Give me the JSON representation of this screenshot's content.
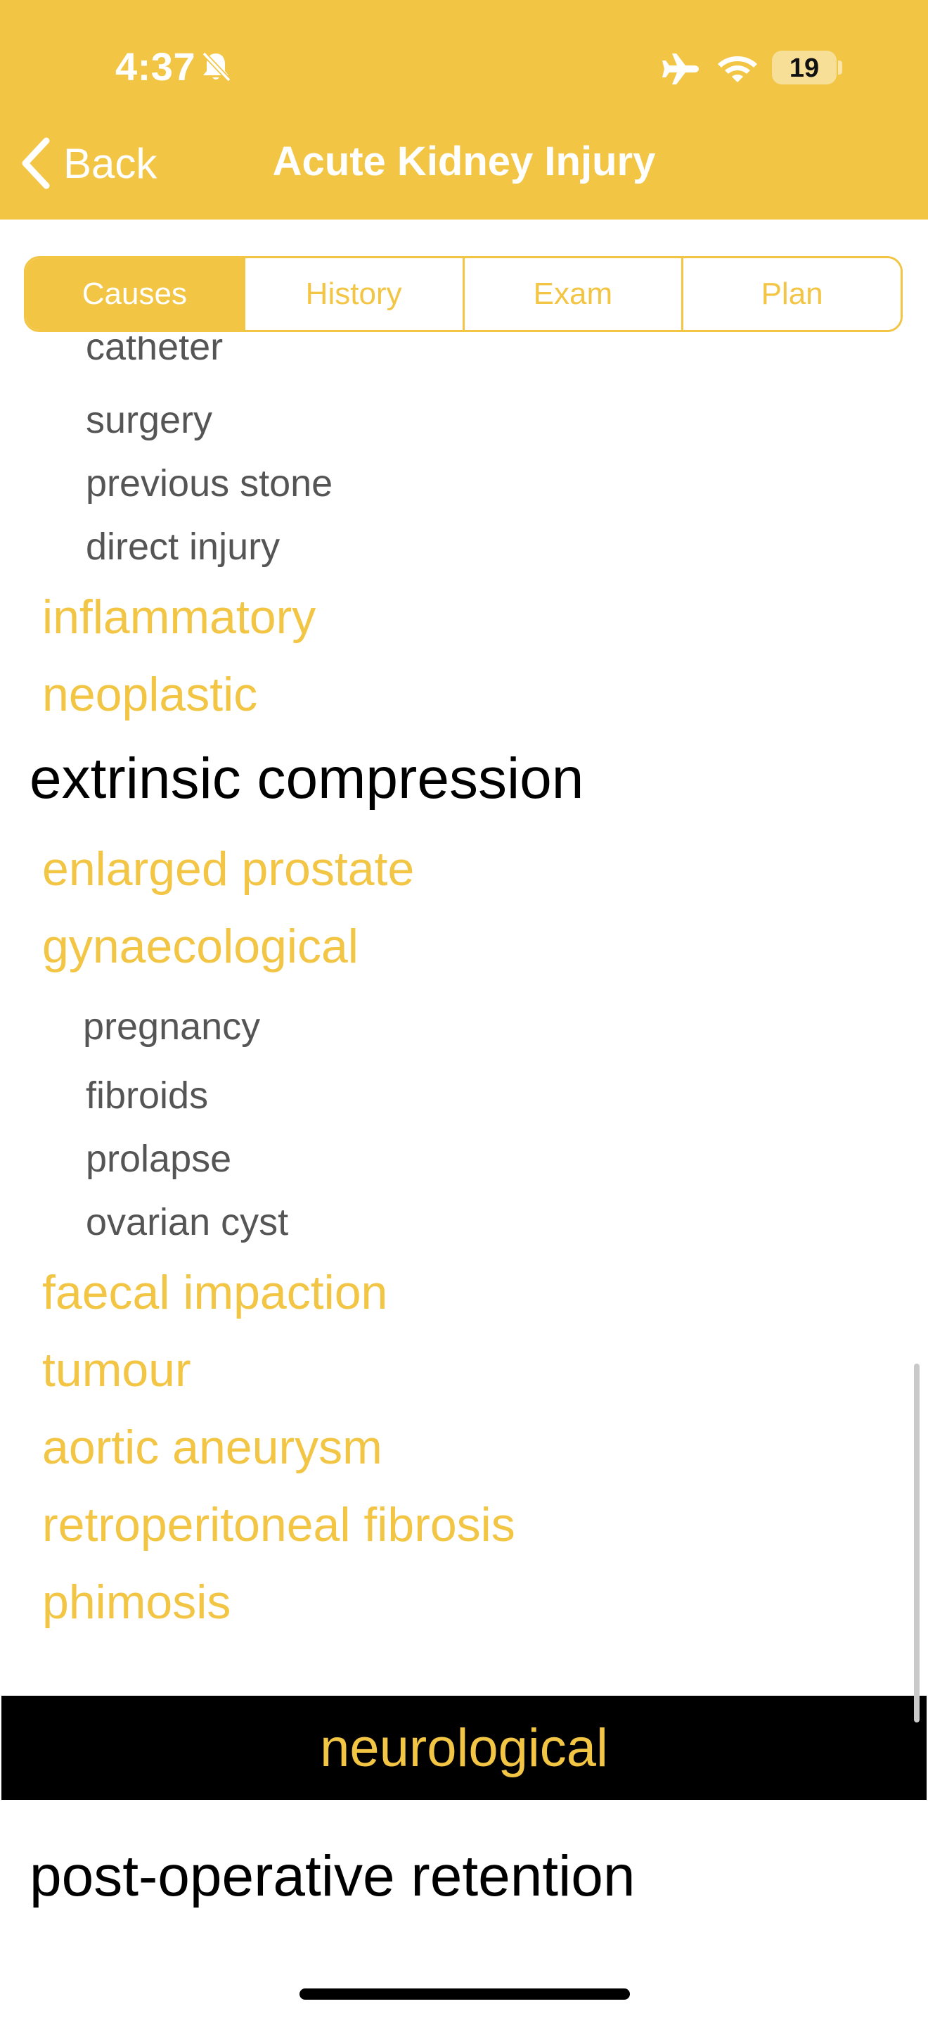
{
  "status_bar": {
    "time": "4:37",
    "battery": "19",
    "icons": [
      "bell-slash-icon",
      "airplane-icon",
      "wifi-icon",
      "battery-icon"
    ]
  },
  "nav": {
    "back_label": "Back",
    "title": "Acute Kidney Injury"
  },
  "tabs": [
    {
      "label": "Causes",
      "active": true
    },
    {
      "label": "History",
      "active": false
    },
    {
      "label": "Exam",
      "active": false
    },
    {
      "label": "Plan",
      "active": false
    }
  ],
  "content": {
    "partial_top": "catheter",
    "sub_items_a": [
      "surgery",
      "previous stone",
      "direct injury"
    ],
    "gold_items_a": [
      "inflammatory",
      "neoplastic"
    ],
    "heading_a": "extrinsic compression",
    "gold_items_b": [
      "enlarged prostate",
      "gynaecological"
    ],
    "sub_items_b": [
      "pregnancy",
      "fibroids",
      "prolapse",
      "ovarian cyst"
    ],
    "gold_items_c": [
      "faecal impaction",
      "tumour",
      "aortic aneurysm",
      "retroperitoneal fibrosis",
      "phimosis"
    ],
    "section": "neurological",
    "heading_b": "post-operative retention"
  },
  "colors": {
    "accent": "#F2C544",
    "sub_text": "#555555",
    "heading": "#000000",
    "section_bar": "#000000"
  }
}
